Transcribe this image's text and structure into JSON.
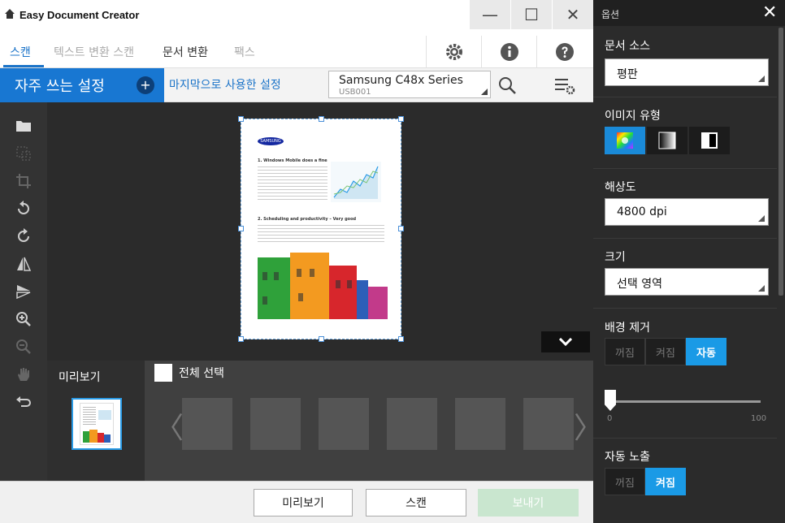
{
  "app": {
    "title": "Easy Document Creator"
  },
  "window_controls": {
    "minimize": "—",
    "maximize": "☐",
    "close": "✕"
  },
  "tabs": [
    {
      "label": "스캔"
    },
    {
      "label": "텍스트 변환 스캔"
    },
    {
      "label": "문서 변환"
    },
    {
      "label": "팩스"
    }
  ],
  "presets": {
    "favorite_label": "자주 쓰는 설정",
    "add_symbol": "+",
    "recent_link": "마지막으로 사용한 설정"
  },
  "device": {
    "name": "Samsung C48x Series",
    "port": "USB001"
  },
  "preview": {
    "title": "미리보기",
    "select_all": "전체 선택",
    "thumb_count": 6
  },
  "footer": {
    "preview_button": "미리보기",
    "scan_button": "스캔",
    "send_button": "보내기"
  },
  "options": {
    "title": "옵션",
    "close": "✕",
    "source": {
      "label": "문서 소스",
      "value": "평판"
    },
    "image_type": {
      "label": "이미지 유형",
      "selected": "color"
    },
    "resolution": {
      "label": "해상도",
      "value": "4800 dpi"
    },
    "size": {
      "label": "크기",
      "value": "선택 영역"
    },
    "background_removal": {
      "label": "배경 제거",
      "options": [
        "꺼짐",
        "켜짐",
        "자동"
      ],
      "selected": "자동"
    },
    "slider": {
      "min": "0",
      "max": "100",
      "value": 0
    },
    "auto_exposure": {
      "label": "자동 노출",
      "options": [
        "꺼짐",
        "켜짐"
      ],
      "selected": "켜짐"
    }
  },
  "document_preview": {
    "brand": "SAMSUNG",
    "heading1": "1. Windows Mobile does a fine",
    "heading2": "2. Scheduling and productivity – Very good"
  },
  "colors": {
    "accent": "#1877d2",
    "toggle_on": "#1a9ae6",
    "panel_bg": "#2b2b2b"
  }
}
